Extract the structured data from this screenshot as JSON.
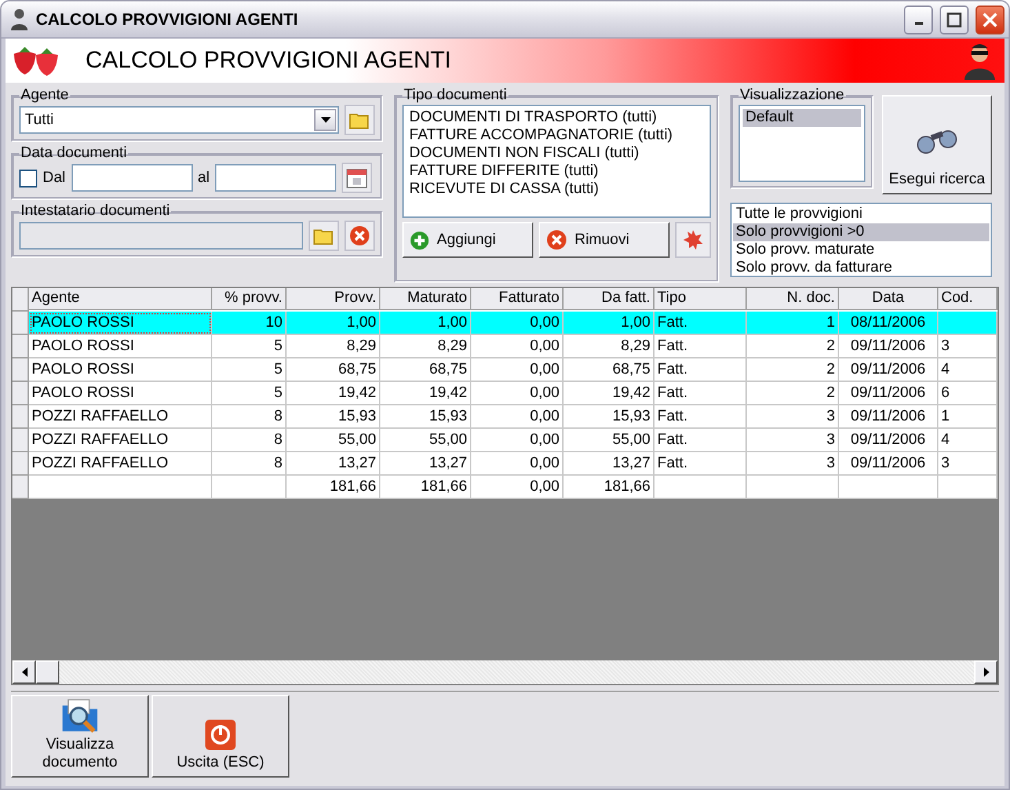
{
  "window": {
    "title": "CALCOLO PROVVIGIONI AGENTI"
  },
  "header": {
    "title": "CALCOLO PROVVIGIONI AGENTI"
  },
  "agente": {
    "label": "Agente",
    "value": "Tutti"
  },
  "data_documenti": {
    "label": "Data documenti",
    "checkbox_label": "Dal",
    "checked": false,
    "to_label": "al"
  },
  "intestatario": {
    "label": "Intestatario documenti"
  },
  "tipo_documenti": {
    "label": "Tipo documenti",
    "items": [
      "DOCUMENTI DI TRASPORTO (tutti)",
      "FATTURE ACCOMPAGNATORIE (tutti)",
      "DOCUMENTI NON FISCALI (tutti)",
      "FATTURE DIFFERITE (tutti)",
      "RICEVUTE DI CASSA (tutti)"
    ],
    "add_button": "Aggiungi",
    "remove_button": "Rimuovi"
  },
  "visualizzazione": {
    "label": "Visualizzazione",
    "items": [
      {
        "label": "Default",
        "selected": true
      }
    ]
  },
  "search_button": "Esegui ricerca",
  "filters": [
    {
      "label": "Tutte le provvigioni",
      "selected": false
    },
    {
      "label": "Solo provvigioni >0",
      "selected": true
    },
    {
      "label": "Solo provv. maturate",
      "selected": false
    },
    {
      "label": "Solo provv. da fatturare",
      "selected": false
    }
  ],
  "table": {
    "columns": [
      "Agente",
      "% provv.",
      "Provv.",
      "Maturato",
      "Fatturato",
      "Da fatt.",
      "Tipo",
      "N. doc.",
      "Data",
      "Cod."
    ],
    "rows": [
      {
        "selected": true,
        "agente": "PAOLO ROSSI",
        "perc": "10",
        "provv": "1,00",
        "maturato": "1,00",
        "fatturato": "0,00",
        "da_fatt": "1,00",
        "tipo": "Fatt.",
        "n_doc": "1",
        "data": "08/11/2006"
      },
      {
        "selected": false,
        "agente": "PAOLO ROSSI",
        "perc": "5",
        "provv": "8,29",
        "maturato": "8,29",
        "fatturato": "0,00",
        "da_fatt": "8,29",
        "tipo": "Fatt.",
        "n_doc": "2",
        "data": "09/11/2006",
        "cod": "3"
      },
      {
        "selected": false,
        "agente": "PAOLO ROSSI",
        "perc": "5",
        "provv": "68,75",
        "maturato": "68,75",
        "fatturato": "0,00",
        "da_fatt": "68,75",
        "tipo": "Fatt.",
        "n_doc": "2",
        "data": "09/11/2006",
        "cod": "4"
      },
      {
        "selected": false,
        "agente": "PAOLO ROSSI",
        "perc": "5",
        "provv": "19,42",
        "maturato": "19,42",
        "fatturato": "0,00",
        "da_fatt": "19,42",
        "tipo": "Fatt.",
        "n_doc": "2",
        "data": "09/11/2006",
        "cod": "6"
      },
      {
        "selected": false,
        "agente": "POZZI RAFFAELLO",
        "perc": "8",
        "provv": "15,93",
        "maturato": "15,93",
        "fatturato": "0,00",
        "da_fatt": "15,93",
        "tipo": "Fatt.",
        "n_doc": "3",
        "data": "09/11/2006",
        "cod": "1"
      },
      {
        "selected": false,
        "agente": "POZZI RAFFAELLO",
        "perc": "8",
        "provv": "55,00",
        "maturato": "55,00",
        "fatturato": "0,00",
        "da_fatt": "55,00",
        "tipo": "Fatt.",
        "n_doc": "3",
        "data": "09/11/2006",
        "cod": "4"
      },
      {
        "selected": false,
        "agente": "POZZI RAFFAELLO",
        "perc": "8",
        "provv": "13,27",
        "maturato": "13,27",
        "fatturato": "0,00",
        "da_fatt": "13,27",
        "tipo": "Fatt.",
        "n_doc": "3",
        "data": "09/11/2006",
        "cod": "3"
      },
      {
        "selected": false,
        "provv": "181,66",
        "maturato": "181,66",
        "fatturato": "0,00",
        "da_fatt": "181,66"
      }
    ]
  },
  "bottom_buttons": [
    {
      "kind": "view",
      "label": "Visualizza documento"
    },
    {
      "kind": "exit",
      "label": "Uscita (ESC)"
    }
  ]
}
